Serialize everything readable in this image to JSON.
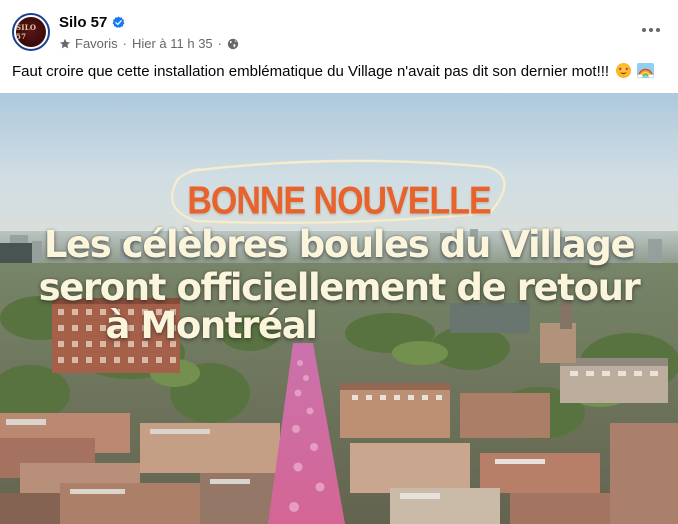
{
  "post": {
    "author": "Silo 57",
    "avatar_text": "SILO 57",
    "verified": true,
    "audience_label": "Favoris",
    "timestamp": "Hier à 11 h 35",
    "separator": "·",
    "message": "Faut croire que cette installation emblématique du Village n'avait pas dit son dernier mot!!!",
    "emojis": [
      "star-struck-emoji",
      "rainbow-emoji"
    ]
  },
  "image": {
    "kicker": "BONNE NOUVELLE",
    "headline_lines": [
      "Les célèbres boules du Village",
      "seront officiellement de retour",
      "à Montréal"
    ]
  },
  "colors": {
    "verified_blue": "#1877f2",
    "secondary_text": "#65676b",
    "kicker_orange": "#e8632c",
    "headline_cream": "#fbf5dc",
    "avatar_maroon": "#3a0a0a"
  },
  "icons": {
    "audience": "star-icon",
    "privacy": "globe-icon",
    "menu": "more-options-icon"
  }
}
